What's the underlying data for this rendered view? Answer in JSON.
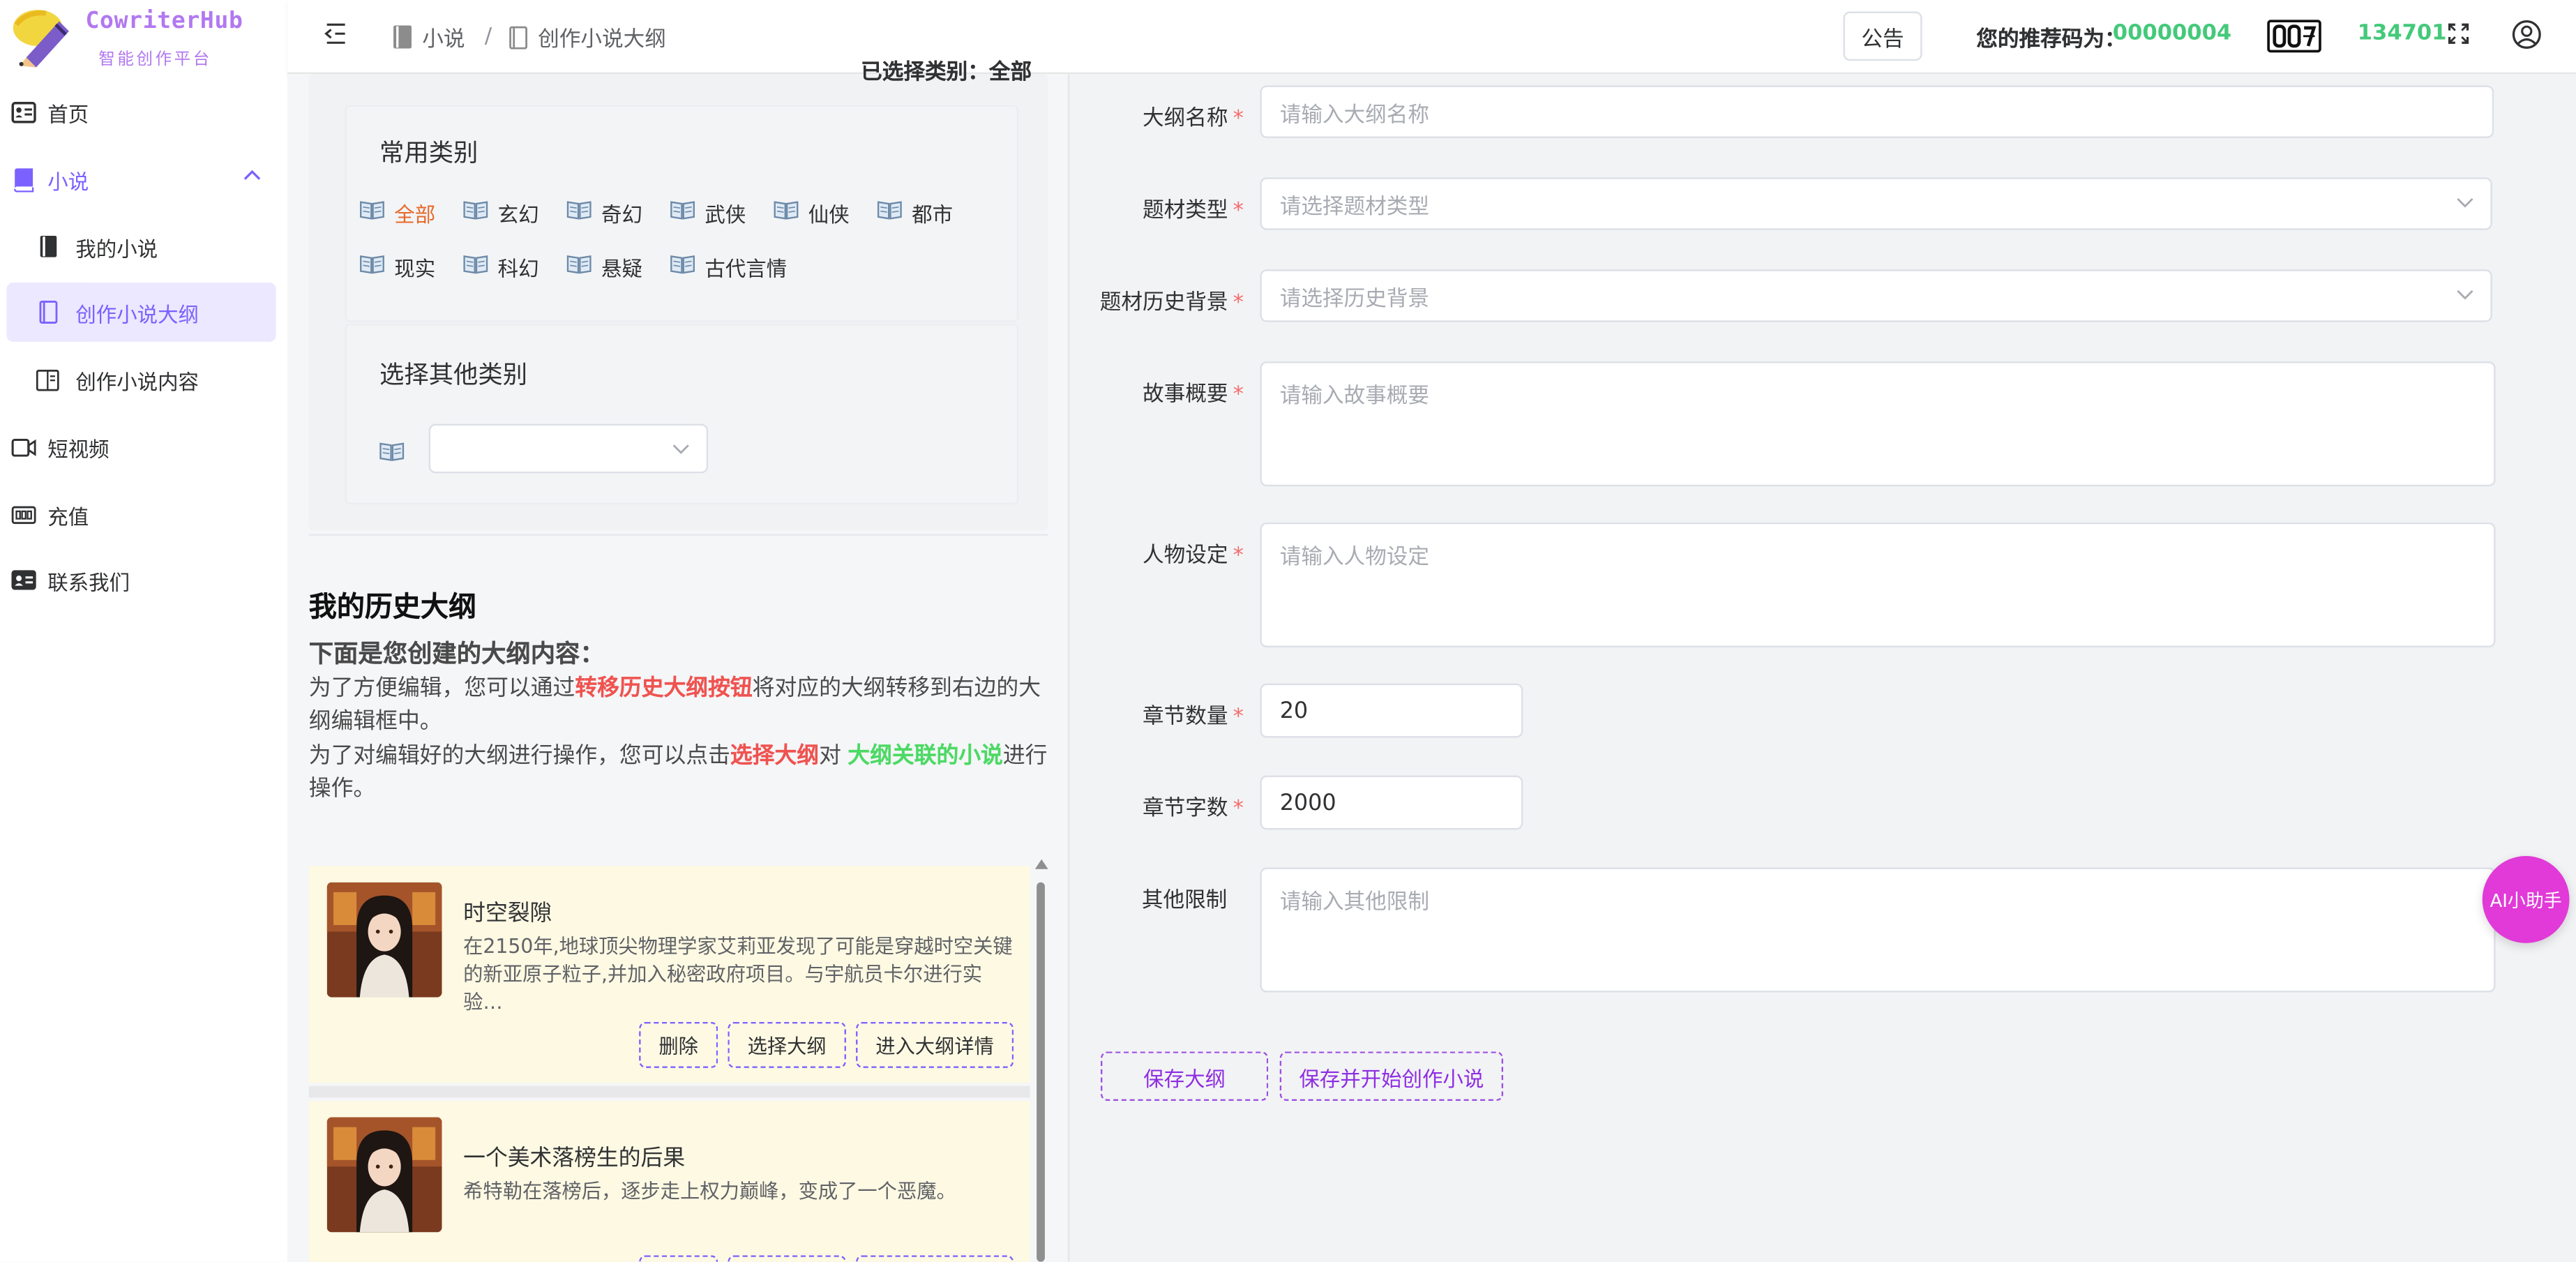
{
  "brand": {
    "name": "CowriterHub",
    "subtitle": "智能创作平台"
  },
  "sidebar": {
    "home": "首页",
    "novel": "小说",
    "novel_children": [
      "我的小说",
      "创作小说大纲",
      "创作小说内容"
    ],
    "short_video": "短视频",
    "recharge": "充值",
    "contact": "联系我们"
  },
  "header": {
    "breadcrumb": [
      "小说",
      "创作小说大纲"
    ],
    "breadcrumb_sep": "/",
    "notice": "公告",
    "referral_label": "您的推荐码为：",
    "referral_code": "00000004",
    "coin_count": "134701"
  },
  "categories": {
    "selected_label": "已选择类别：全部",
    "common_title": "常用类别",
    "common": [
      "全部",
      "玄幻",
      "奇幻",
      "武侠",
      "仙侠",
      "都市",
      "现实",
      "科幻",
      "悬疑",
      "古代言情"
    ],
    "selected": "全部",
    "other_title": "选择其他类别"
  },
  "history": {
    "title": "我的历史大纲",
    "subtitle": "下面是您创建的大纲内容：",
    "p1_pre": "为了方便编辑，您可以通过",
    "p1_em": "转移历史大纲按钮",
    "p1_post": "将对应的大纲转移到右边的大纲编辑框中。",
    "p2_pre": "为了对编辑好的大纲进行操作，您可以点击",
    "p2_em1": "选择大纲",
    "p2_mid": "对",
    "p2_em2": "大纲关联的小说",
    "p2_post": "进行操作。",
    "cards": [
      {
        "title": "时空裂隙",
        "desc": "在2150年,地球顶尖物理学家艾莉亚发现了可能是穿越时空关键的新亚原子粒子,并加入秘密政府项目。与宇航员卡尔进行实验…"
      },
      {
        "title": "一个美术落榜生的后果",
        "desc": "希特勒在落榜后，逐步走上权力巅峰，变成了一个恶魔。"
      }
    ],
    "buttons": {
      "delete": "删除",
      "select": "选择大纲",
      "detail": "进入大纲详情"
    }
  },
  "form": {
    "name_label": "大纲名称",
    "name_placeholder": "请输入大纲名称",
    "genre_label": "题材类型",
    "genre_placeholder": "请选择题材类型",
    "background_label": "题材历史背景",
    "background_placeholder": "请选择历史背景",
    "summary_label": "故事概要",
    "summary_placeholder": "请输入故事概要",
    "characters_label": "人物设定",
    "characters_placeholder": "请输入人物设定",
    "chapters_label": "章节数量",
    "chapters_value": "20",
    "words_label": "章节字数",
    "words_value": "2000",
    "other_label": "其他限制",
    "other_placeholder": "请输入其他限制",
    "required_mark": "*",
    "save": "保存大纲",
    "save_and_start": "保存并开始创作小说"
  },
  "ai_assistant": "AI小助手",
  "colors": {
    "accent": "#7b61ff",
    "green": "#44c97a",
    "orange": "#e6692a",
    "red": "#ef5350",
    "magenta": "#e13ad8",
    "card_bg": "#fdf9e3"
  }
}
